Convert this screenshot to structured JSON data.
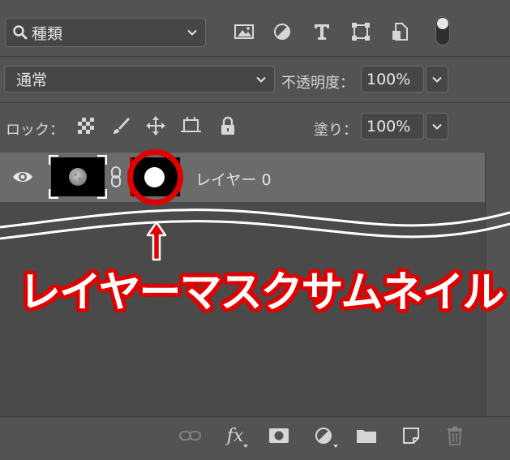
{
  "filter": {
    "icon": "search-icon",
    "label": "種類"
  },
  "filter_icons": [
    "image-filter-icon",
    "adjustment-filter-icon",
    "type-filter-icon",
    "shape-filter-icon",
    "smart-object-filter-icon"
  ],
  "blend": {
    "mode": "通常"
  },
  "opacity": {
    "label": "不透明度：",
    "value": "100%"
  },
  "lock": {
    "label": "ロック：",
    "icons": [
      "lock-transparent-icon",
      "lock-image-icon",
      "lock-position-icon",
      "lock-artboard-icon",
      "lock-all-icon"
    ]
  },
  "fill": {
    "label": "塗り：",
    "value": "100%"
  },
  "layer": {
    "name": "レイヤー 0"
  },
  "annotation": {
    "callout": "レイヤーマスクサムネイル",
    "color": "#e00000"
  },
  "footer_icons": [
    "link-layers-icon",
    "fx-icon",
    "add-mask-icon",
    "adjustment-layer-icon",
    "group-folder-icon",
    "new-layer-icon",
    "trash-icon"
  ],
  "footer_fx": "fx"
}
